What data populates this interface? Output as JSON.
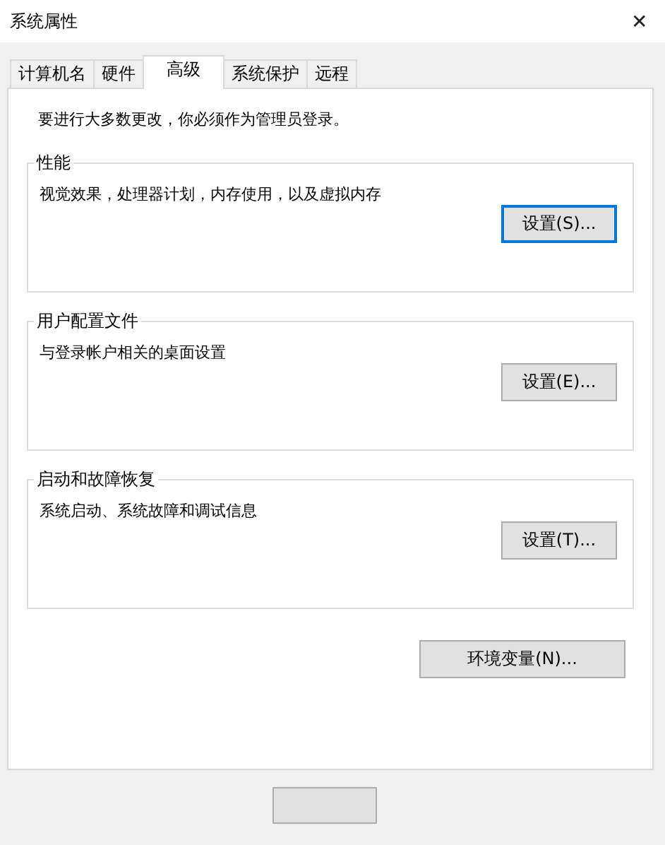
{
  "window": {
    "title": "系统属性",
    "close": "✕"
  },
  "tabs": [
    {
      "label": "计算机名",
      "selected": false
    },
    {
      "label": "硬件",
      "selected": false
    },
    {
      "label": "高级",
      "selected": true
    },
    {
      "label": "系统保护",
      "selected": false
    },
    {
      "label": "远程",
      "selected": false
    }
  ],
  "notice": "要进行大多数更改，你必须作为管理员登录。",
  "groups": [
    {
      "title": "性能",
      "description": "视觉效果，处理器计划，内存使用，以及虚拟内存",
      "button": "设置(S)...",
      "focused": true
    },
    {
      "title": "用户配置文件",
      "description": "与登录帐户相关的桌面设置",
      "button": "设置(E)...",
      "focused": false
    },
    {
      "title": "启动和故障恢复",
      "description": "系统启动、系统故障和调试信息",
      "button": "设置(T)...",
      "focused": false
    }
  ],
  "env_button": "环境变量(N)..."
}
